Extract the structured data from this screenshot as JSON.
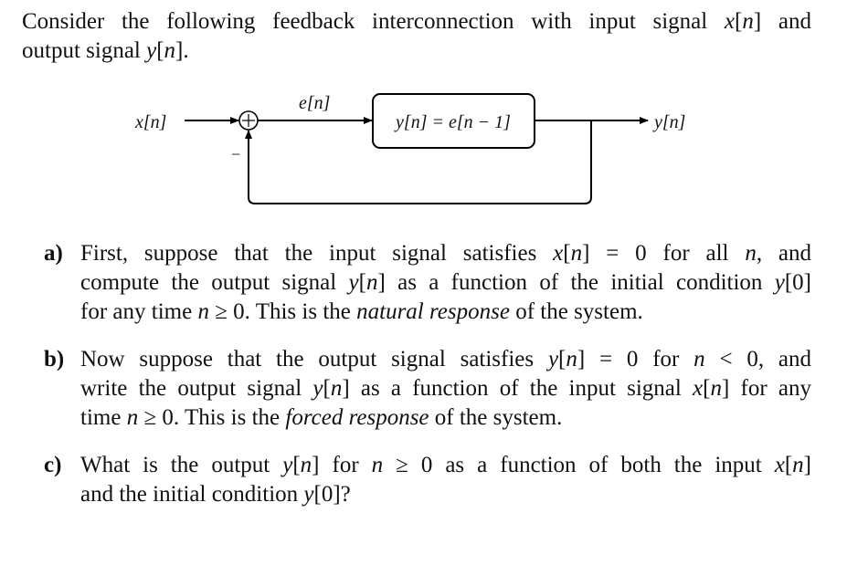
{
  "intro": {
    "line1": [
      "Consider the following feedback interconnection with input signal ",
      "x",
      "[",
      "n",
      "]",
      " and"
    ],
    "line2": [
      "output signal ",
      "y",
      "[",
      "n",
      "]",
      "."
    ]
  },
  "diagram": {
    "input_label": "x[n]",
    "error_label": "e[n]",
    "block_equation": "y[n] = e[n − 1]",
    "output_label": "y[n]",
    "sum_symbol": "+",
    "feedback_sign": "−"
  },
  "questions": [
    {
      "marker": "a)",
      "lines": [
        [
          "First, suppose that the input signal satisfies ",
          {
            "m": "x"
          },
          "[",
          {
            "m": "n"
          },
          "] = 0 for all ",
          {
            "m": "n"
          },
          ", and"
        ],
        [
          "compute the output signal ",
          {
            "m": "y"
          },
          "[",
          {
            "m": "n"
          },
          "] as a function of the initial condition ",
          {
            "m": "y"
          },
          "[0]"
        ],
        [
          "for any time ",
          {
            "m": "n"
          },
          " ≥ 0. This is the ",
          {
            "em": "natural response"
          },
          " of the system."
        ]
      ]
    },
    {
      "marker": "b)",
      "lines": [
        [
          "Now suppose that the output signal satisfies ",
          {
            "m": "y"
          },
          "[",
          {
            "m": "n"
          },
          "] = 0 for ",
          {
            "m": "n"
          },
          " < 0, and"
        ],
        [
          "write the output signal ",
          {
            "m": "y"
          },
          "[",
          {
            "m": "n"
          },
          "] as a function of the input signal ",
          {
            "m": "x"
          },
          "[",
          {
            "m": "n"
          },
          "] for any"
        ],
        [
          "time ",
          {
            "m": "n"
          },
          " ≥ 0. This is the ",
          {
            "em": "forced response"
          },
          " of the system."
        ]
      ]
    },
    {
      "marker": "c)",
      "lines": [
        [
          "What is the output ",
          {
            "m": "y"
          },
          "[",
          {
            "m": "n"
          },
          "] for ",
          {
            "m": "n"
          },
          " ≥ 0 as a function of both the input ",
          {
            "m": "x"
          },
          "[",
          {
            "m": "n"
          },
          "]"
        ],
        [
          "and the initial condition ",
          {
            "m": "y"
          },
          "[0]?"
        ]
      ]
    }
  ]
}
